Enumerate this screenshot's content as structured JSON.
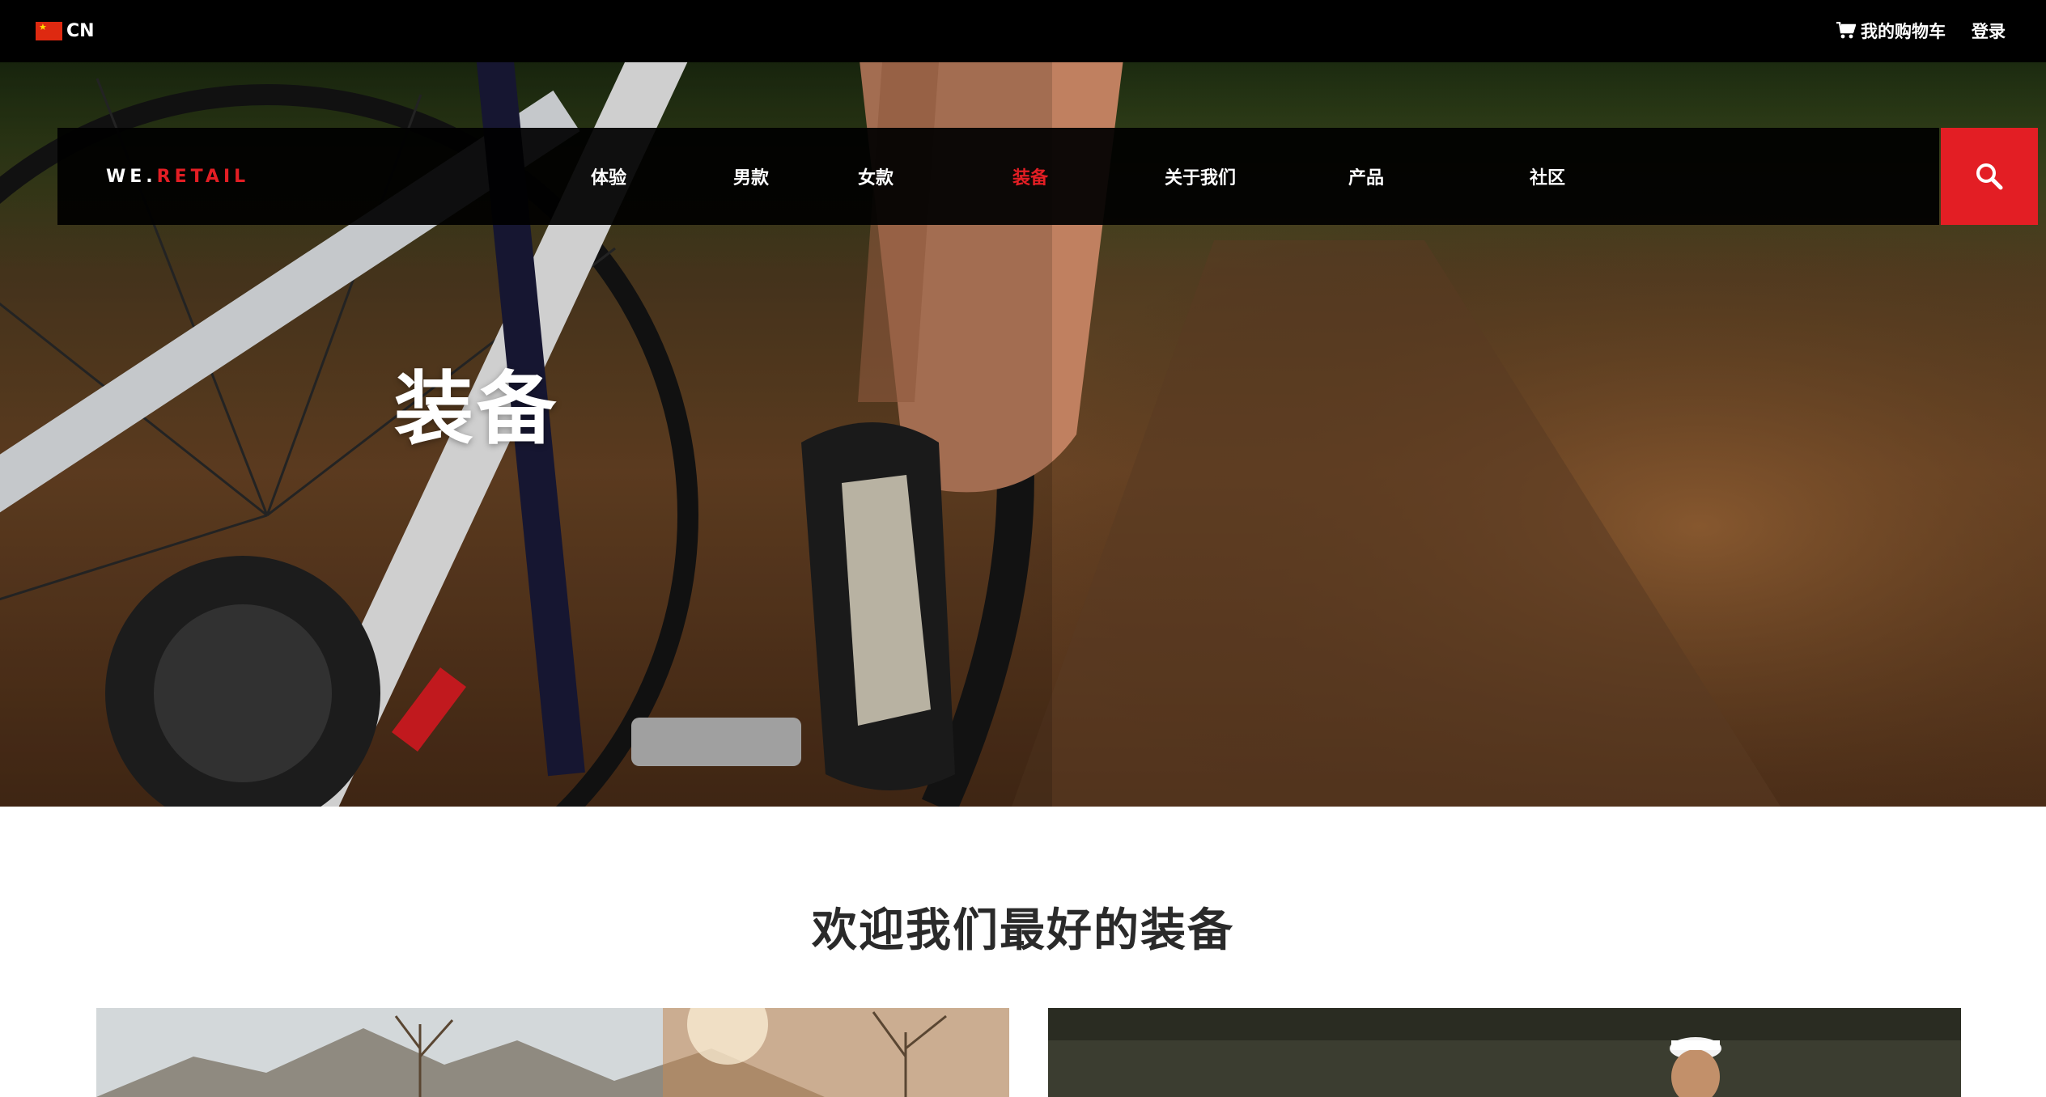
{
  "topbar": {
    "language_code": "CN",
    "cart_label": "我的购物车",
    "login_label": "登录"
  },
  "logo": {
    "prefix": "WE.",
    "suffix": "RETAIL"
  },
  "nav": {
    "items": [
      {
        "label": "体验"
      },
      {
        "label": "男款"
      },
      {
        "label": "女款"
      },
      {
        "label": "装备",
        "active": true
      },
      {
        "label": "关于我们"
      },
      {
        "label": "产品"
      },
      {
        "label": "社区"
      }
    ]
  },
  "hero": {
    "title": "装备"
  },
  "section": {
    "title": "欢迎我们最好的装备"
  },
  "colors": {
    "accent": "#e31e24",
    "topbar_bg": "#000000",
    "navbar_bg": "#000000",
    "page_bg": "#ffffff"
  }
}
